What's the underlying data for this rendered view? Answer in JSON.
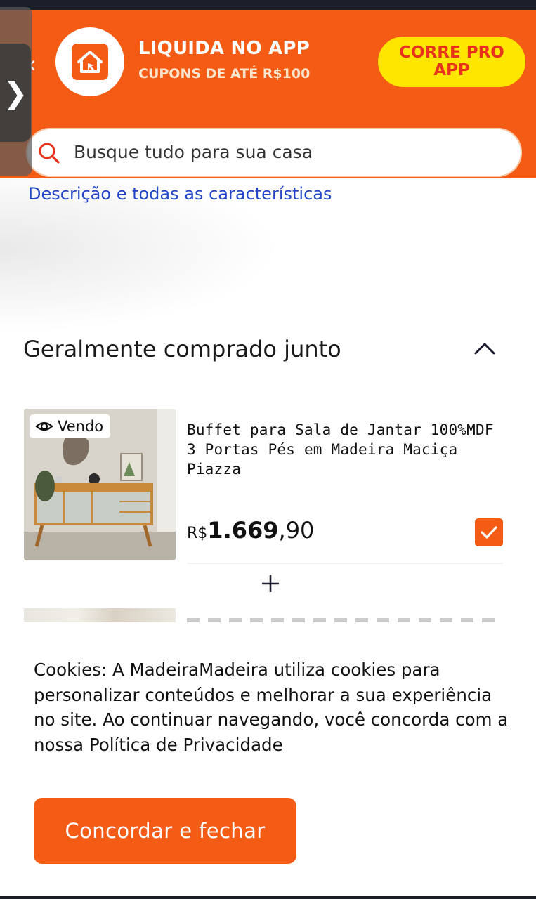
{
  "header": {
    "promo_title": "LIQUIDA NO APP",
    "promo_subtitle": "CUPONS DE ATÉ R$100",
    "cta_label": "CORRE PRO\nAPP",
    "search_placeholder": "Busque tudo para sua casa",
    "logo_icon": "madeiramadeira-house-logo",
    "back_icon": "chevron-left-icon"
  },
  "side_tab": {
    "icon": "chevron-right-icon",
    "glyph": "❯"
  },
  "description_link": "Descrição e todas as características",
  "section": {
    "title": "Geralmente comprado junto",
    "state": "expanded"
  },
  "products": [
    {
      "badge": "Vendo",
      "title": "Buffet para Sala de Jantar 100%MDF 3 Portas Pés em Madeira Maciça Piazza",
      "price_currency": "R$",
      "price_integer": "1.669",
      "price_decimal": ",90",
      "selected": true
    }
  ],
  "combine_symbol": "+",
  "cookie": {
    "text": "Cookies: A MadeiraMadeira utiliza cookies para personalizar conteúdos e melhorar a sua experiência no site. Ao continuar navegando, você concorda com a nossa Política de Privacidade",
    "button_label": "Concordar e fechar"
  },
  "colors": {
    "brand_orange": "#f45b14",
    "cta_yellow": "#ffe600",
    "cta_text_red": "#e8331c",
    "link_blue": "#2246c7"
  }
}
